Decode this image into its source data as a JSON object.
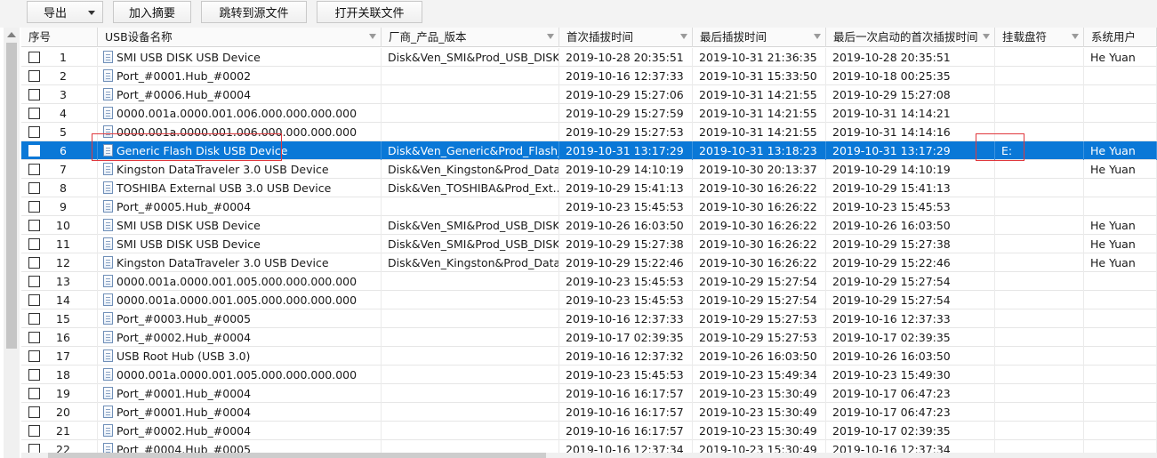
{
  "toolbar": {
    "export_label": "导出",
    "add_abstract_label": "加入摘要",
    "jump_source_label": "跳转到源文件",
    "open_related_label": "打开关联文件"
  },
  "columns": [
    "序号",
    "USB设备名称",
    "厂商_产品_版本",
    "首次插拔时间",
    "最后插拔时间",
    "最后一次启动的首次插拔时间",
    "挂载盘符",
    "系统用户"
  ],
  "rows": [
    {
      "idx": "1",
      "name": "SMI USB DISK USB Device",
      "vendor": "Disk&Ven_SMI&Prod_USB_DISK...",
      "first": "2019-10-28 20:35:51",
      "last": "2019-10-31 21:36:35",
      "boot_first": "2019-10-28 20:35:51",
      "drive": "",
      "user": "He Yuan"
    },
    {
      "idx": "2",
      "name": "Port_#0001.Hub_#0002",
      "vendor": "",
      "first": "2019-10-16 12:37:33",
      "last": "2019-10-31 15:33:50",
      "boot_first": "2019-10-18 00:25:35",
      "drive": "",
      "user": ""
    },
    {
      "idx": "3",
      "name": "Port_#0006.Hub_#0004",
      "vendor": "",
      "first": "2019-10-29 15:27:06",
      "last": "2019-10-31 14:21:55",
      "boot_first": "2019-10-29 15:27:08",
      "drive": "",
      "user": ""
    },
    {
      "idx": "4",
      "name": "0000.001a.0000.001.006.000.000.000.000",
      "vendor": "",
      "first": "2019-10-29 15:27:59",
      "last": "2019-10-31 14:21:55",
      "boot_first": "2019-10-31 14:14:21",
      "drive": "",
      "user": ""
    },
    {
      "idx": "5",
      "name": "0000.001a.0000.001.006.000.000.000.000",
      "vendor": "",
      "first": "2019-10-29 15:27:53",
      "last": "2019-10-31 14:21:55",
      "boot_first": "2019-10-31 14:14:16",
      "drive": "",
      "user": ""
    },
    {
      "idx": "6",
      "name": "Generic Flash Disk USB Device",
      "vendor": "Disk&Ven_Generic&Prod_Flash_...",
      "first": "2019-10-31 13:17:29",
      "last": "2019-10-31 13:18:23",
      "boot_first": "2019-10-31 13:17:29",
      "drive": "E:",
      "user": "He Yuan"
    },
    {
      "idx": "7",
      "name": "Kingston DataTraveler 3.0 USB Device",
      "vendor": "Disk&Ven_Kingston&Prod_Data...",
      "first": "2019-10-29 14:10:19",
      "last": "2019-10-30 20:13:37",
      "boot_first": "2019-10-29 14:10:19",
      "drive": "",
      "user": "He Yuan"
    },
    {
      "idx": "8",
      "name": "TOSHIBA External USB 3.0 USB Device",
      "vendor": "Disk&Ven_TOSHIBA&Prod_Ext...",
      "first": "2019-10-29 15:41:13",
      "last": "2019-10-30 16:26:22",
      "boot_first": "2019-10-29 15:41:13",
      "drive": "",
      "user": ""
    },
    {
      "idx": "9",
      "name": "Port_#0005.Hub_#0004",
      "vendor": "",
      "first": "2019-10-23 15:45:53",
      "last": "2019-10-30 16:26:22",
      "boot_first": "2019-10-23 15:45:53",
      "drive": "",
      "user": ""
    },
    {
      "idx": "10",
      "name": "SMI USB DISK USB Device",
      "vendor": "Disk&Ven_SMI&Prod_USB_DISK...",
      "first": "2019-10-26 16:03:50",
      "last": "2019-10-30 16:26:22",
      "boot_first": "2019-10-26 16:03:50",
      "drive": "",
      "user": "He Yuan"
    },
    {
      "idx": "11",
      "name": "SMI USB DISK USB Device",
      "vendor": "Disk&Ven_SMI&Prod_USB_DISK...",
      "first": "2019-10-29 15:27:38",
      "last": "2019-10-30 16:26:22",
      "boot_first": "2019-10-29 15:27:38",
      "drive": "",
      "user": "He Yuan"
    },
    {
      "idx": "12",
      "name": "Kingston DataTraveler 3.0 USB Device",
      "vendor": "Disk&Ven_Kingston&Prod_Data...",
      "first": "2019-10-29 15:22:46",
      "last": "2019-10-30 16:26:22",
      "boot_first": "2019-10-29 15:22:46",
      "drive": "",
      "user": "He Yuan"
    },
    {
      "idx": "13",
      "name": "0000.001a.0000.001.005.000.000.000.000",
      "vendor": "",
      "first": "2019-10-23 15:45:53",
      "last": "2019-10-29 15:27:54",
      "boot_first": "2019-10-29 15:27:54",
      "drive": "",
      "user": ""
    },
    {
      "idx": "14",
      "name": "0000.001a.0000.001.005.000.000.000.000",
      "vendor": "",
      "first": "2019-10-23 15:45:53",
      "last": "2019-10-29 15:27:54",
      "boot_first": "2019-10-29 15:27:54",
      "drive": "",
      "user": ""
    },
    {
      "idx": "15",
      "name": "Port_#0003.Hub_#0005",
      "vendor": "",
      "first": "2019-10-16 12:37:33",
      "last": "2019-10-29 15:27:53",
      "boot_first": "2019-10-16 12:37:33",
      "drive": "",
      "user": ""
    },
    {
      "idx": "16",
      "name": "Port_#0002.Hub_#0004",
      "vendor": "",
      "first": "2019-10-17 02:39:35",
      "last": "2019-10-29 15:27:53",
      "boot_first": "2019-10-17 02:39:35",
      "drive": "",
      "user": ""
    },
    {
      "idx": "17",
      "name": "USB Root Hub (USB 3.0)",
      "vendor": "",
      "first": "2019-10-16 12:37:32",
      "last": "2019-10-26 16:03:50",
      "boot_first": "2019-10-26 16:03:50",
      "drive": "",
      "user": ""
    },
    {
      "idx": "18",
      "name": "0000.001a.0000.001.005.000.000.000.000",
      "vendor": "",
      "first": "2019-10-23 15:45:53",
      "last": "2019-10-23 15:49:34",
      "boot_first": "2019-10-23 15:49:30",
      "drive": "",
      "user": ""
    },
    {
      "idx": "19",
      "name": "Port_#0001.Hub_#0004",
      "vendor": "",
      "first": "2019-10-16 16:17:57",
      "last": "2019-10-23 15:30:49",
      "boot_first": "2019-10-17 06:47:23",
      "drive": "",
      "user": ""
    },
    {
      "idx": "20",
      "name": "Port_#0001.Hub_#0004",
      "vendor": "",
      "first": "2019-10-16 16:17:57",
      "last": "2019-10-23 15:30:49",
      "boot_first": "2019-10-17 06:47:23",
      "drive": "",
      "user": ""
    },
    {
      "idx": "21",
      "name": "Port_#0002.Hub_#0004",
      "vendor": "",
      "first": "2019-10-16 16:17:57",
      "last": "2019-10-23 15:30:49",
      "boot_first": "2019-10-17 02:39:35",
      "drive": "",
      "user": ""
    },
    {
      "idx": "22",
      "name": "Port_#0004.Hub_#0005",
      "vendor": "",
      "first": "2019-10-16 12:37:34",
      "last": "2019-10-23 15:30:49",
      "boot_first": "2019-10-16 12:37:34",
      "drive": "",
      "user": ""
    }
  ],
  "selected_row": "6",
  "colors": {
    "selection": "#0a78d7",
    "highlight_box": "#e0393e"
  }
}
